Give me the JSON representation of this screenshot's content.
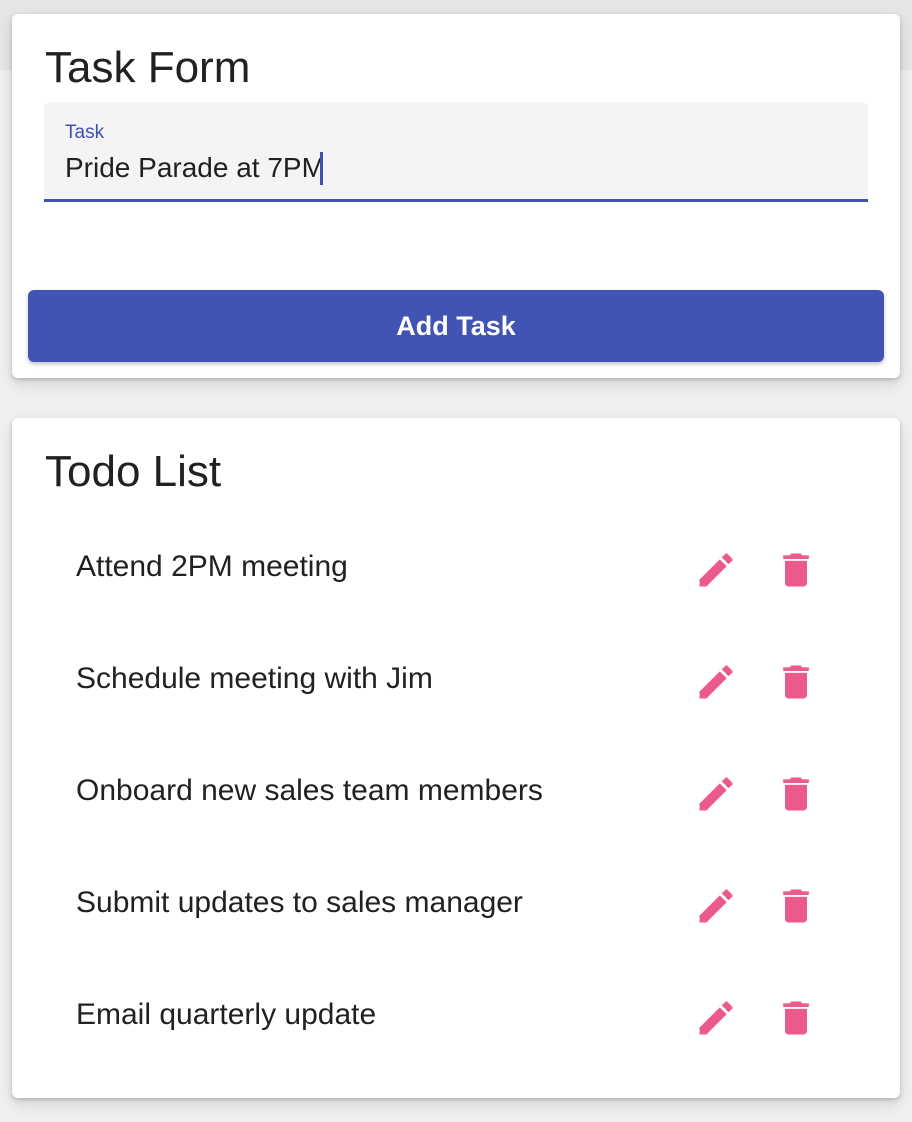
{
  "colors": {
    "primary": "#3f51b5",
    "accent": "#ec5a8a",
    "text": "#212121",
    "card": "#ffffff"
  },
  "task_form": {
    "title": "Task Form",
    "field_label": "Task",
    "field_value": "Pride Parade at 7PM",
    "submit_label": "Add Task"
  },
  "todo_list": {
    "title": "Todo List",
    "items": [
      {
        "text": "Attend 2PM meeting",
        "edit_icon": "pencil-icon",
        "delete_icon": "trash-icon"
      },
      {
        "text": "Schedule meeting with Jim",
        "edit_icon": "pencil-icon",
        "delete_icon": "trash-icon"
      },
      {
        "text": "Onboard new sales team members",
        "edit_icon": "pencil-icon",
        "delete_icon": "trash-icon"
      },
      {
        "text": "Submit updates to sales manager",
        "edit_icon": "pencil-icon",
        "delete_icon": "trash-icon"
      },
      {
        "text": "Email quarterly update",
        "edit_icon": "pencil-icon",
        "delete_icon": "trash-icon"
      }
    ]
  }
}
